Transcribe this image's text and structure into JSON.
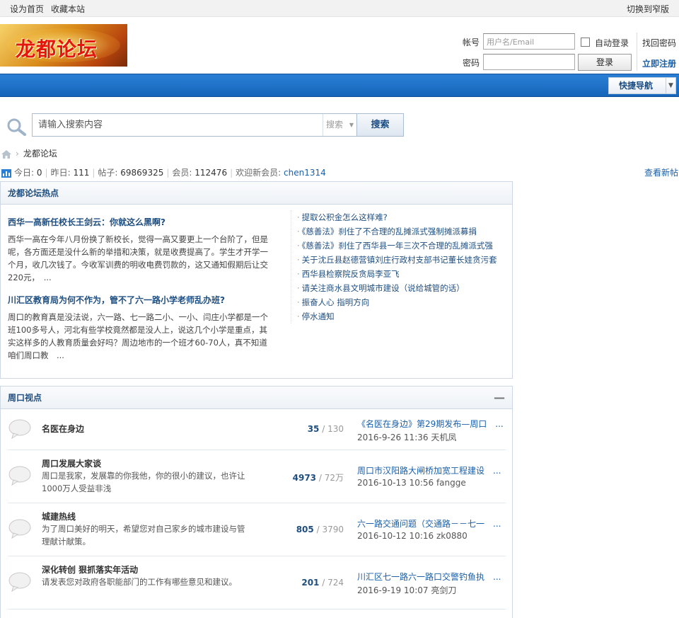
{
  "topbar": {
    "set_home": "设为首页",
    "bookmark": "收藏本站",
    "switch_width": "切换到窄版"
  },
  "logo": {
    "text": "龙都论坛"
  },
  "login": {
    "user_label": "帐号",
    "user_placeholder": "用户名/Email",
    "pw_label": "密码",
    "auto_login": "自动登录",
    "login_btn": "登录",
    "find_pw": "找回密码",
    "register": "立即注册"
  },
  "nav": {
    "quick_nav": "快捷导航"
  },
  "search": {
    "placeholder": "请输入搜索内容",
    "type": "搜索",
    "button": "搜索"
  },
  "breadcrumb": {
    "current": "龙都论坛"
  },
  "stats": {
    "today_label": "今日:",
    "today": "0",
    "yesterday_label": "昨日:",
    "yesterday": "111",
    "posts_label": "帖子:",
    "posts": "69869325",
    "members_label": "会员:",
    "members": "112476",
    "welcome_label": "欢迎新会员:",
    "newest_member": "chen1314",
    "new_posts": "查看新帖"
  },
  "hot": {
    "title": "龙都论坛热点",
    "featured": [
      {
        "title": "西华一高新任校长王剑云：你就这么黑啊?",
        "body": "西华一高在今年八月份换了新校长，觉得一高又要更上一个台阶了，但是呢，各方面还是没什么新的举措和决策，就是收费提高了。学生才开学一个月，收几次钱了。今收军训费的明收电费罚款的，这又通知假期后让交220元，　..."
      },
      {
        "title": "川汇区教育局为何不作为，管不了六一路小学老师乱办班?",
        "body": "周口的教育真是没法说，六一路、七一路二小、一小、闫庄小学都是一个班100多号人，河北有些学校竟然都是没人上，说这几个小学是重点，其实这样多的人教育质量会好吗？周边地市的一个班才60-70人，真不知道咱们周口教　..."
      }
    ],
    "links": [
      "提取公积金怎么这样难?",
      "《慈善法》刹住了不合理的乱摊派式强制摊派募捐",
      "《慈善法》刹住了西华县一年三次不合理的乱摊派式强",
      "关于沈丘县赵德营镇刘庄行政村支部书记董长娃贪污套",
      "西华县检察院反贪局李亚飞",
      "请关注商水县文明城市建设（说给城管的话）",
      "振奋人心  指明方向",
      "停水通知"
    ]
  },
  "section": {
    "title": "周口视点",
    "collapse": "—",
    "forums": [
      {
        "name": "名医在身边",
        "desc": "",
        "topics": "35",
        "posts": "130",
        "last_title": "《名医在身边》第29期发布—周口　...",
        "last_meta": "2016-9-26 11:36 天机凤"
      },
      {
        "name": "周口发展大家谈",
        "desc": "周口是我家，发展靠的你我他，你的很小的建议，也许让1000万人受益非浅",
        "topics": "4973",
        "posts": "72万",
        "last_title": "周口市汉阳路大闸桥加宽工程建设　...",
        "last_meta": "2016-10-13 10:56 fangge"
      },
      {
        "name": "城建热线",
        "desc": "为了周口美好的明天，希望您对自己家乡的城市建设与管理献计献策。",
        "topics": "805",
        "posts": "3790",
        "last_title": "六一路交通问题（交通路－－七一　...",
        "last_meta": "2016-10-12 10:16 zk0880"
      },
      {
        "name": "深化转创  狠抓落实年活动",
        "desc": "请发表您对政府各职能部门的工作有哪些意见和建议。",
        "topics": "201",
        "posts": "724",
        "last_title": "川汇区七一路六一路口交警钓鱼执　...",
        "last_meta": "2016-9-19 10:07 亮剑刀"
      }
    ]
  }
}
